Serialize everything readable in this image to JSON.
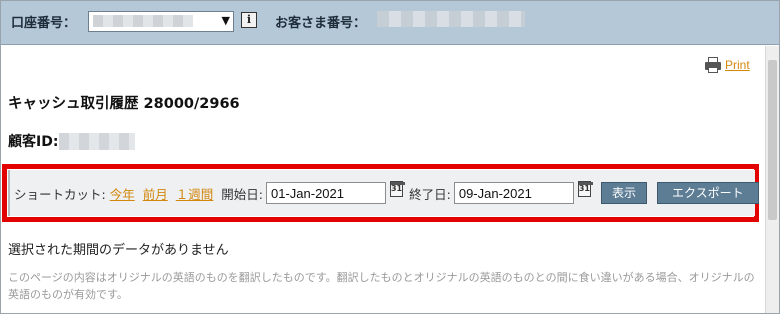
{
  "header": {
    "account_label": "口座番号：",
    "account_value": "",
    "customer_no_label": "お客さま番号：",
    "info_glyph": "i"
  },
  "print": {
    "label": "Print"
  },
  "page": {
    "title": "キャッシュ取引履歴 28000/2966",
    "customer_id_label": "顧客ID:"
  },
  "filters": {
    "shortcut_label": "ショートカット:",
    "shortcuts": [
      "今年",
      "前月",
      "１週間"
    ],
    "start_label": "開始日:",
    "start_value": "01-Jan-2021",
    "end_label": "終了日:",
    "end_value": "09-Jan-2021",
    "show_button": "表示",
    "export_button": "エクスポート"
  },
  "results": {
    "no_data": "選択された期間のデータがありません",
    "disclaimer": "このページの内容はオリジナルの英語のものを翻訳したものです。翻訳したものとオリジナルの英語のものとの間に食い違いがある場合、オリジナルの英語のものが有効です。"
  },
  "colors": {
    "header_bg": "#b4c8d8",
    "link": "#d4870e",
    "highlight": "#e20000",
    "button_bg": "#5d7d95"
  },
  "icons": [
    "chevron-down-icon",
    "info-icon",
    "printer-icon",
    "calendar-icon"
  ]
}
